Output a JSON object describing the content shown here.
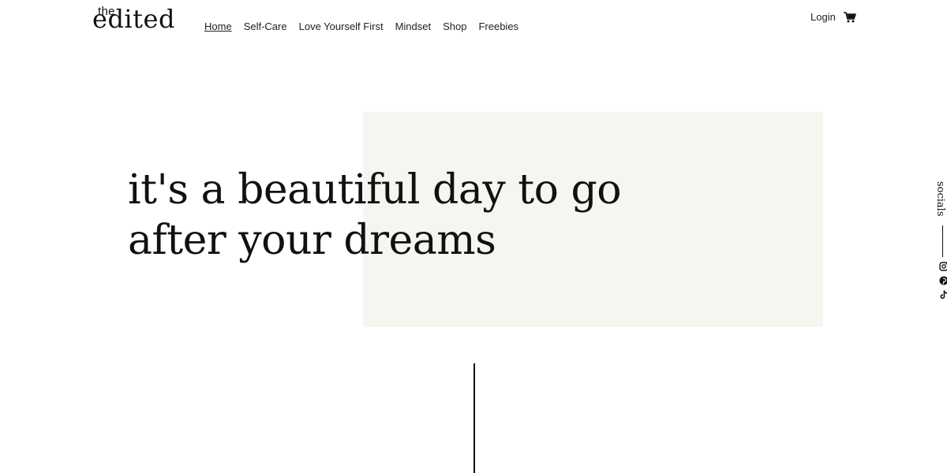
{
  "header": {
    "logo_top": "the",
    "logo_main": "edited",
    "nav": [
      {
        "label": "Home",
        "active": true
      },
      {
        "label": "Self-Care"
      },
      {
        "label": "Love Yourself First"
      },
      {
        "label": "Mindset"
      },
      {
        "label": "Shop"
      },
      {
        "label": "Freebies"
      }
    ],
    "login_label": "Login",
    "cart_icon": "shopping-cart-icon"
  },
  "hero": {
    "title": "it's a beautiful day to go after your dreams",
    "box_color": "#f7f5ef"
  },
  "socials": {
    "label": "socials",
    "icons": [
      "instagram-icon",
      "pinterest-icon",
      "tiktok-icon"
    ]
  }
}
